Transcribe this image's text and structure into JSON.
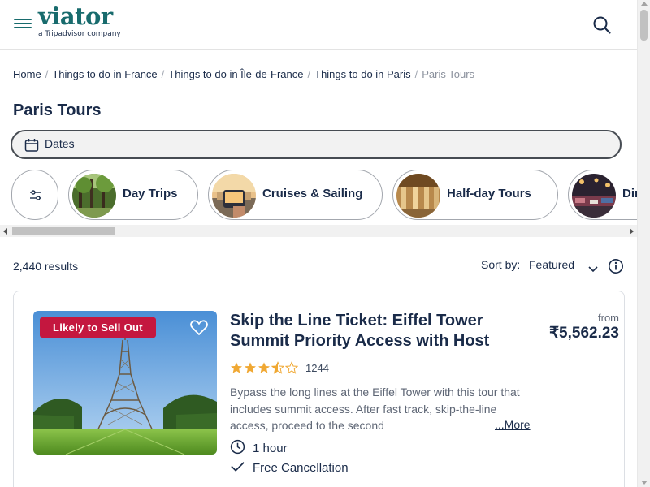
{
  "header": {
    "logo_text": "viator",
    "logo_tagline": "a Tripadvisor company",
    "brand_color": "#186b6d"
  },
  "breadcrumb": [
    {
      "label": "Home"
    },
    {
      "label": "Things to do in France"
    },
    {
      "label": "Things to do in Île-de-France"
    },
    {
      "label": "Things to do in Paris"
    },
    {
      "label": "Paris Tours",
      "current": true
    }
  ],
  "page_title": "Paris Tours",
  "dates": {
    "label": "Dates"
  },
  "categories": [
    {
      "label": "Day Trips",
      "icon": "forest-thumbnail"
    },
    {
      "label": "Cruises & Sailing",
      "icon": "boat-thumbnail"
    },
    {
      "label": "Half-day Tours",
      "icon": "palace-thumbnail"
    },
    {
      "label": "Din",
      "icon": "dinner-thumbnail"
    }
  ],
  "results": {
    "count": "2,440 results",
    "sort_label": "Sort by:",
    "sort_value": "Featured"
  },
  "product": {
    "badge": "Likely to Sell Out",
    "title": "Skip the Line Ticket: Eiffel Tower Summit Priority Access with Host",
    "rating": 3.5,
    "review_count": "1244",
    "description": "Bypass the long lines at the Eiffel Tower with this tour that includes summit access. After fast track, skip-the-line access, proceed to the second",
    "more_label": "...More",
    "duration": "1 hour",
    "cancellation": "Free Cancellation",
    "price_from": "from",
    "price": "₹5,562.23",
    "badge_color": "#c4173f",
    "star_color": "#f0a833"
  }
}
